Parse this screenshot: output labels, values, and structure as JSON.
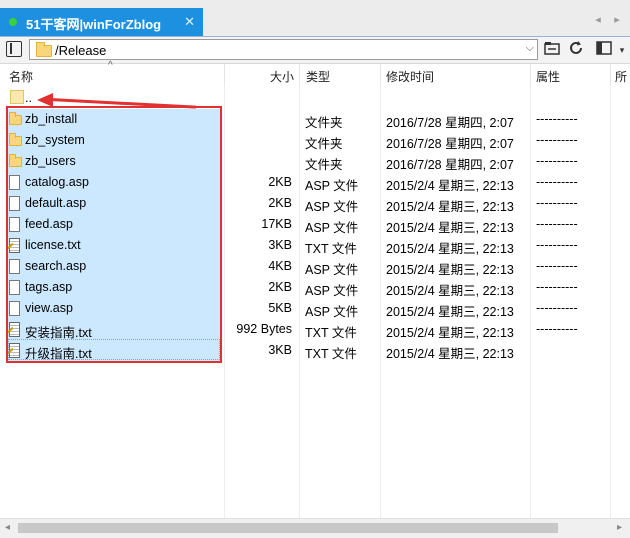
{
  "tab": {
    "title": "51干客网|winForZblog",
    "close": "✕"
  },
  "tab_nav": {
    "prev": "◂",
    "next": "▸"
  },
  "toolbar": {
    "path": "/Release",
    "path_dropdown": "⌵"
  },
  "icons": {
    "panel": "sidebar-toggle-icon",
    "open_folder": "folder-open-icon",
    "refresh": "refresh-icon",
    "view": "view-mode-icon"
  },
  "columns": {
    "name": "名称",
    "size": "大小",
    "type": "类型",
    "modified": "修改时间",
    "attributes": "属性",
    "owner": "所"
  },
  "parent": {
    "name": ".."
  },
  "files": [
    {
      "name": "zb_install",
      "size": "",
      "type": "文件夹",
      "modified": "2016/7/28 星期四, 2:07",
      "attr": "----------",
      "kind": "folder"
    },
    {
      "name": "zb_system",
      "size": "",
      "type": "文件夹",
      "modified": "2016/7/28 星期四, 2:07",
      "attr": "----------",
      "kind": "folder"
    },
    {
      "name": "zb_users",
      "size": "",
      "type": "文件夹",
      "modified": "2016/7/28 星期四, 2:07",
      "attr": "----------",
      "kind": "folder"
    },
    {
      "name": "catalog.asp",
      "size": "2KB",
      "type": "ASP 文件",
      "modified": "2015/2/4 星期三, 22:13",
      "attr": "----------",
      "kind": "file"
    },
    {
      "name": "default.asp",
      "size": "2KB",
      "type": "ASP 文件",
      "modified": "2015/2/4 星期三, 22:13",
      "attr": "----------",
      "kind": "file"
    },
    {
      "name": "feed.asp",
      "size": "17KB",
      "type": "ASP 文件",
      "modified": "2015/2/4 星期三, 22:13",
      "attr": "----------",
      "kind": "file"
    },
    {
      "name": "license.txt",
      "size": "3KB",
      "type": "TXT 文件",
      "modified": "2015/2/4 星期三, 22:13",
      "attr": "----------",
      "kind": "txt"
    },
    {
      "name": "search.asp",
      "size": "4KB",
      "type": "ASP 文件",
      "modified": "2015/2/4 星期三, 22:13",
      "attr": "----------",
      "kind": "file"
    },
    {
      "name": "tags.asp",
      "size": "2KB",
      "type": "ASP 文件",
      "modified": "2015/2/4 星期三, 22:13",
      "attr": "----------",
      "kind": "file"
    },
    {
      "name": "view.asp",
      "size": "5KB",
      "type": "ASP 文件",
      "modified": "2015/2/4 星期三, 22:13",
      "attr": "----------",
      "kind": "file"
    },
    {
      "name": "安装指南.txt",
      "size": "992 Bytes",
      "type": "TXT 文件",
      "modified": "2015/2/4 星期三, 22:13",
      "attr": "----------",
      "kind": "txt"
    },
    {
      "name": "升级指南.txt",
      "size": "3KB",
      "type": "TXT 文件",
      "modified": "2015/2/4 星期三, 22:13",
      "attr": "",
      "kind": "txt"
    }
  ],
  "scrollbar": {
    "left": "◂",
    "right": "▸"
  },
  "colors": {
    "tab_active": "#1e90e0",
    "selection": "#cce8ff",
    "annotation": "#e23131",
    "folder": "#f9d67a"
  }
}
